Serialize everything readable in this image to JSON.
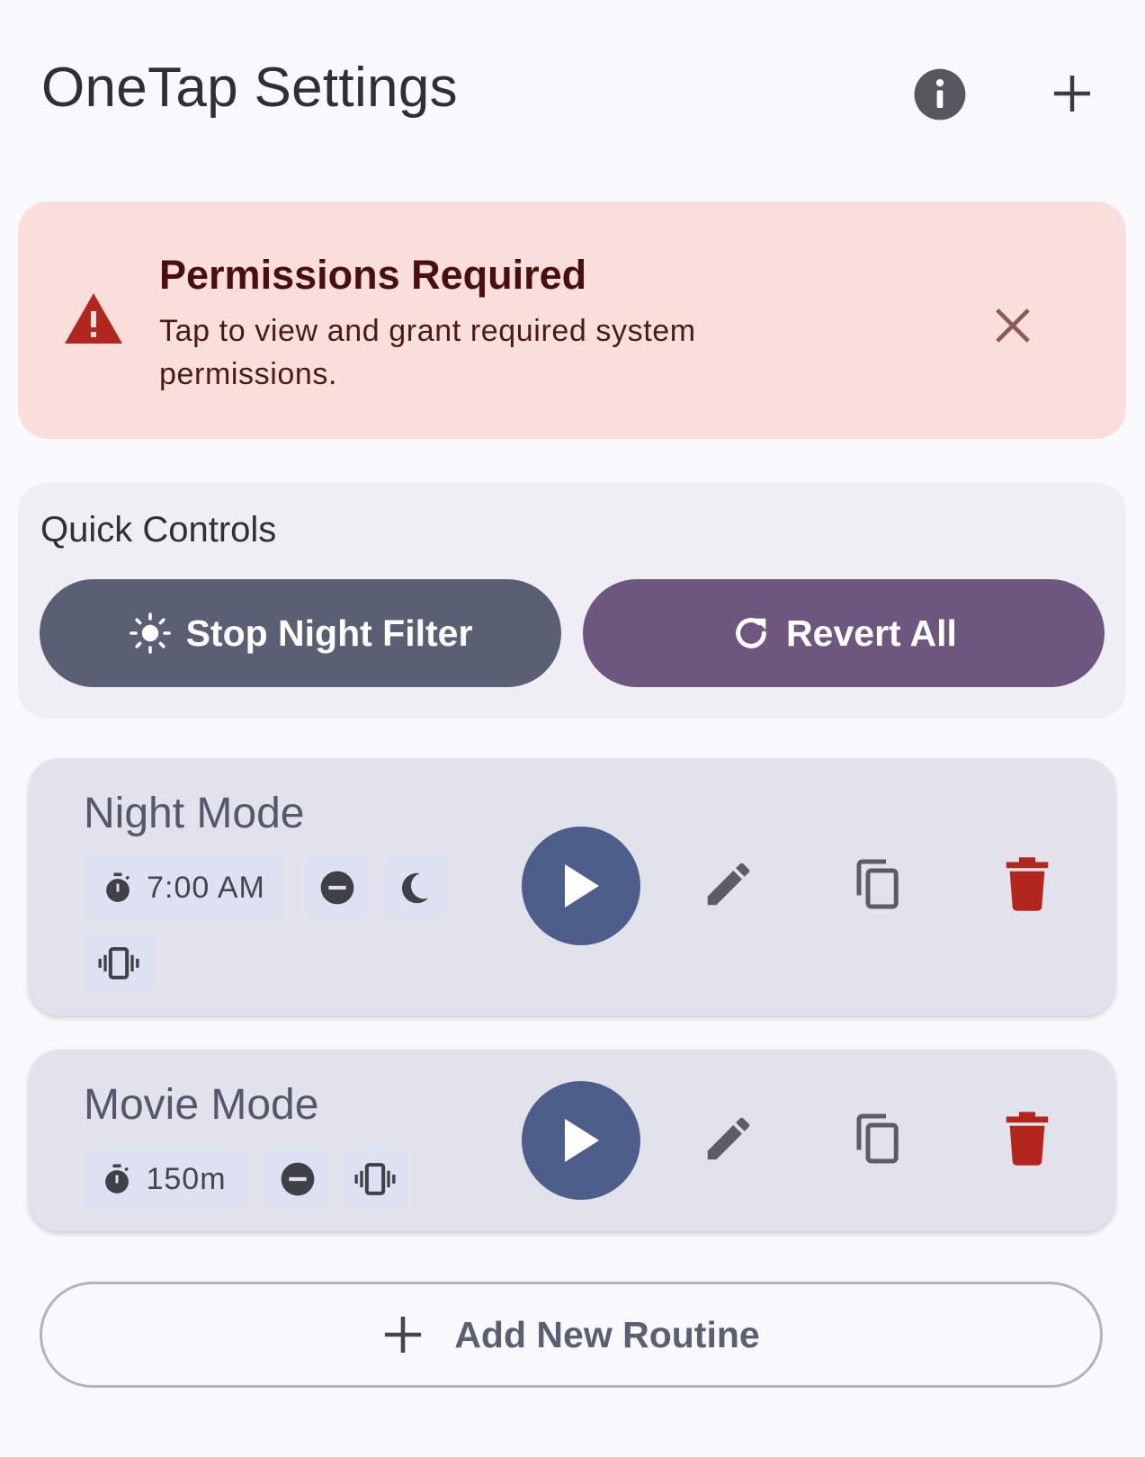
{
  "app_bar": {
    "title": "OneTap Settings",
    "info_icon": "info-icon",
    "add_icon": "plus-icon"
  },
  "permissions_banner": {
    "icon": "warning-icon",
    "title": "Permissions Required",
    "body": "Tap to view and grant required system permissions.",
    "close_icon": "close-icon",
    "colors": {
      "background": "#fadedb",
      "icon": "#b3261e"
    }
  },
  "quick_controls": {
    "title": "Quick Controls",
    "stop_night_filter": {
      "label": "Stop Night Filter",
      "icon": "sun-icon",
      "color": "#5a5f73"
    },
    "revert_all": {
      "label": "Revert All",
      "icon": "refresh-icon",
      "color": "#6e577e"
    }
  },
  "routines": [
    {
      "name": "Night Mode",
      "trigger": {
        "icon": "timer-icon",
        "label": "7:00 AM"
      },
      "settings_icons": [
        "do-not-disturb-icon",
        "moon-icon",
        "vibrate-icon"
      ],
      "actions": [
        "play-icon",
        "edit-icon",
        "copy-icon",
        "delete-icon"
      ]
    },
    {
      "name": "Movie Mode",
      "trigger": {
        "icon": "timer-icon",
        "label": "150m"
      },
      "settings_icons": [
        "do-not-disturb-icon",
        "vibrate-icon"
      ],
      "actions": [
        "play-icon",
        "edit-icon",
        "copy-icon",
        "delete-icon"
      ]
    }
  ],
  "add_routine": {
    "label": "Add New Routine",
    "icon": "plus-icon"
  },
  "colors": {
    "play": "#4d5e8a",
    "delete": "#b3261e",
    "chip": "#dde1f2"
  }
}
